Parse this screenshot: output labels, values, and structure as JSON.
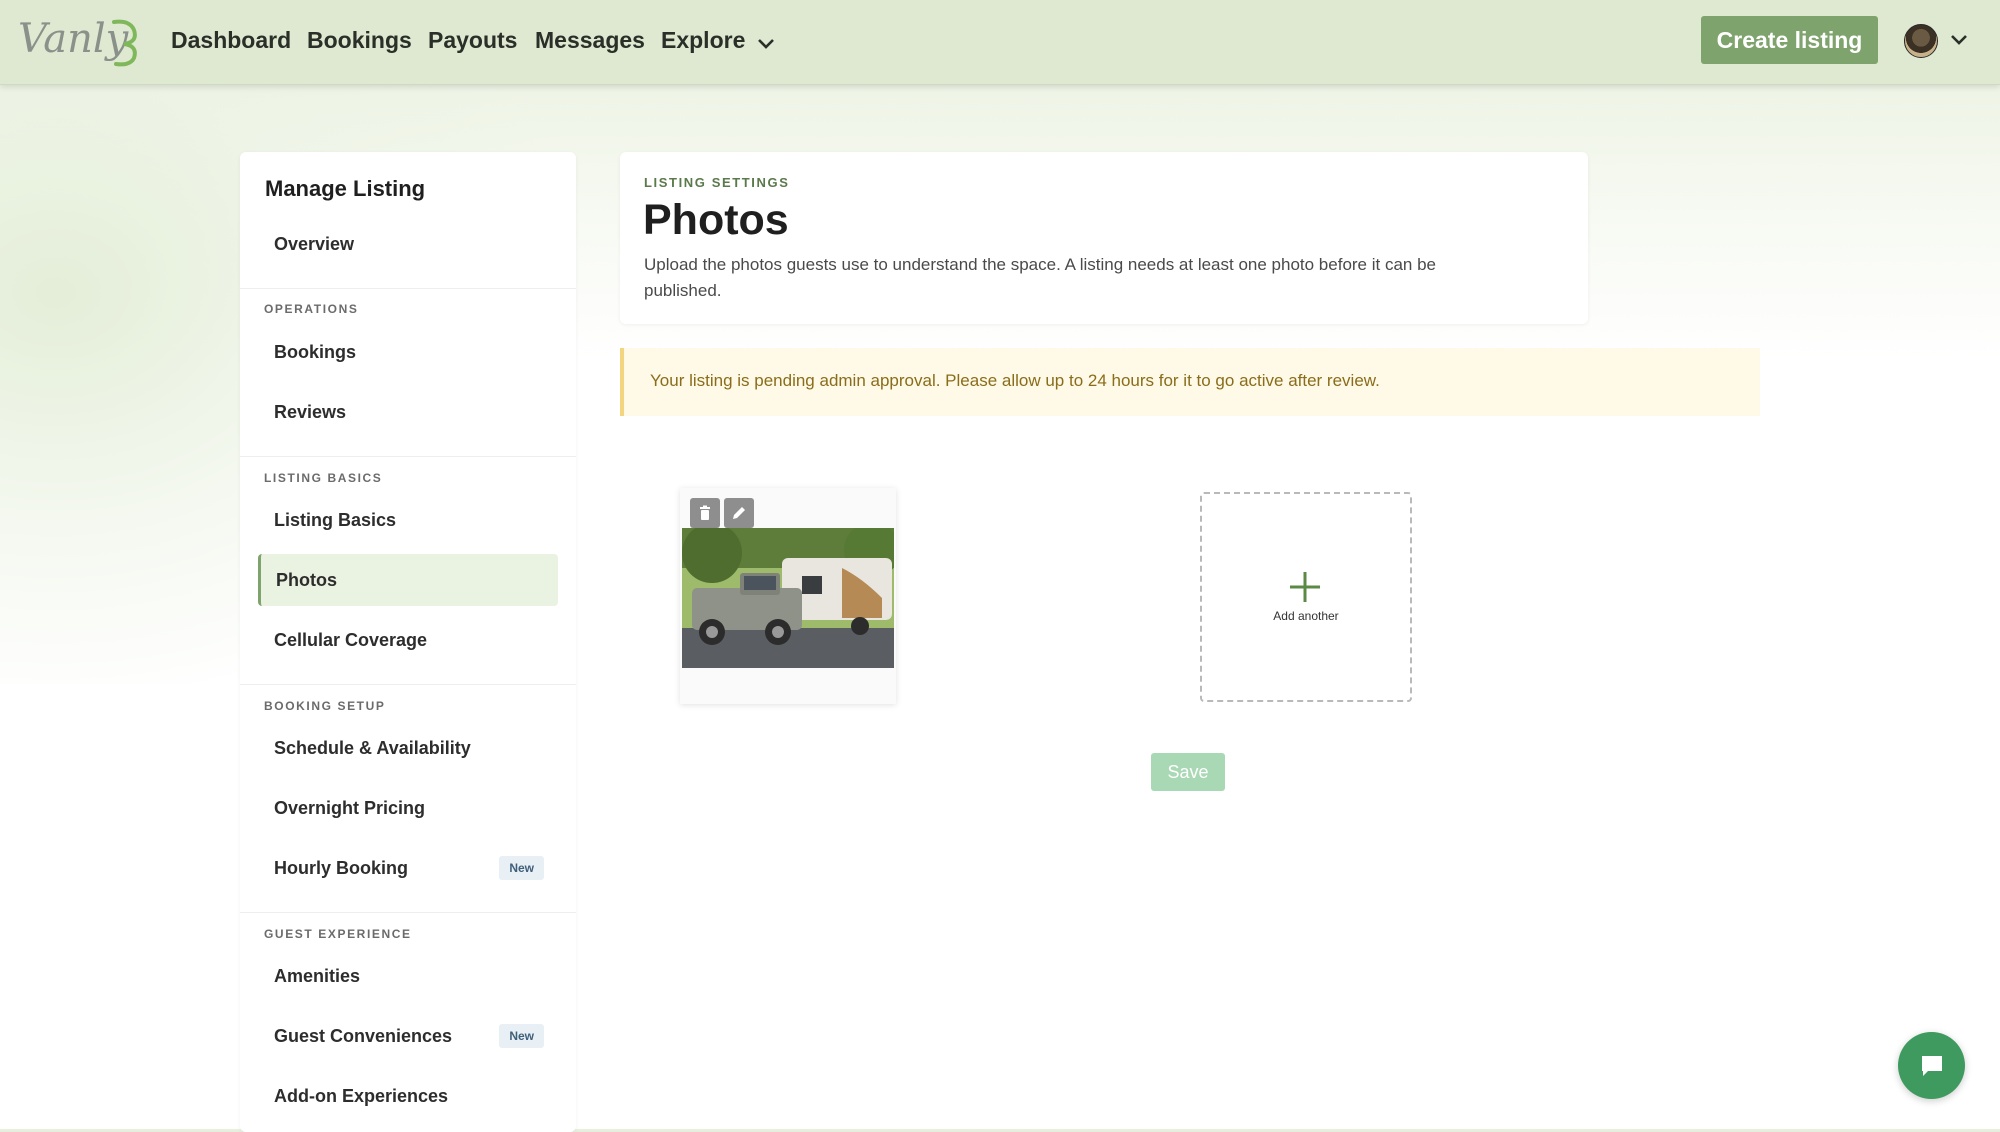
{
  "nav": {
    "logo_text": "Vanly",
    "links": [
      "Dashboard",
      "Bookings",
      "Payouts",
      "Messages",
      "Explore"
    ],
    "create_label": "Create listing"
  },
  "sidebar": {
    "title": "Manage Listing",
    "overview": "Overview",
    "sections": {
      "operations": "OPERATIONS",
      "listing_basics": "LISTING BASICS",
      "booking_setup": "BOOKING SETUP",
      "guest_experience": "GUEST EXPERIENCE"
    },
    "items": {
      "bookings": "Bookings",
      "reviews": "Reviews",
      "listing_basics": "Listing Basics",
      "photos": "Photos",
      "cellular": "Cellular Coverage",
      "schedule": "Schedule & Availability",
      "overnight": "Overnight Pricing",
      "hourly": "Hourly Booking",
      "amenities": "Amenities",
      "conveniences": "Guest Conveniences",
      "addons": "Add-on Experiences"
    },
    "badge_new": "New",
    "active_item": "Photos"
  },
  "header": {
    "eyebrow": "LISTING SETTINGS",
    "title": "Photos",
    "description": "Upload the photos guests use to understand the space. A listing needs at least one photo before it can be published."
  },
  "alert": {
    "text": "Your listing is pending admin approval. Please allow up to 24 hours for it to go active after review."
  },
  "photos": {
    "add_label": "Add another",
    "save_label": "Save"
  },
  "icons": {
    "nav_chevron": "chevron-down-icon",
    "delete": "trash-icon",
    "edit": "pencil-icon",
    "add": "plus-icon",
    "chat": "chat-icon"
  },
  "colors": {
    "brand": "#7fa36c",
    "save_disabled": "#a9d8b5",
    "chat": "#3e9a5e",
    "alert_bg": "#fff9e8",
    "alert_text": "#8a6d1a"
  }
}
